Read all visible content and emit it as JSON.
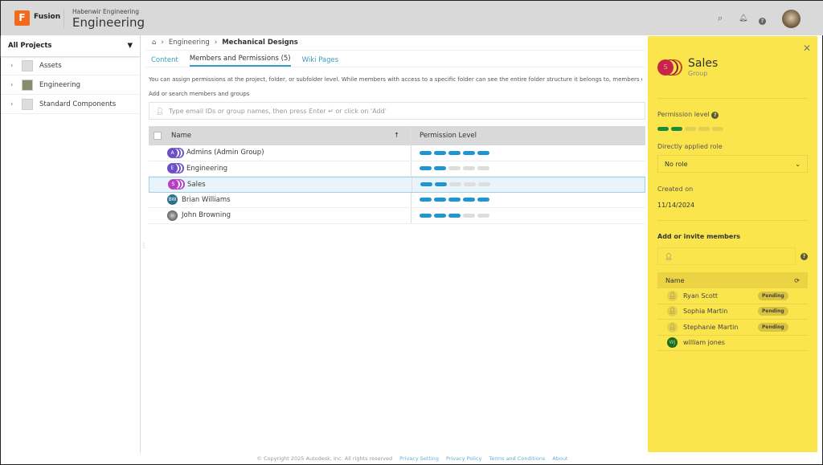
{
  "header": {
    "app": "Fusion",
    "logo_letter": "F",
    "hub": "Habenwir Engineering",
    "project": "Engineering",
    "icons": [
      "search-icon",
      "bell-icon",
      "help-icon",
      "user-avatar"
    ]
  },
  "sidebar": {
    "title": "All Projects",
    "items": [
      {
        "label": "Assets"
      },
      {
        "label": "Engineering"
      },
      {
        "label": "Standard Components"
      }
    ]
  },
  "breadcrumb": {
    "items": [
      "Engineering",
      "Mechanical Designs"
    ]
  },
  "tabs": [
    {
      "label": "Content"
    },
    {
      "label": "Members and Permissions (5)"
    },
    {
      "label": "Wiki Pages"
    }
  ],
  "info": "You can assign permissions at the project, folder, or subfolder level. While members with access to a specific folder can see the entire folder structure it belongs to, members can on",
  "add_label": "Add or search members and groups",
  "search_placeholder": "Type email IDs or group names, then press Enter ↵ or click on 'Add'",
  "table": {
    "headers": [
      "Name",
      "Permission Level"
    ],
    "rows": [
      {
        "name": "Admins (Admin Group)",
        "initials": "A",
        "level": 5,
        "color": "#6a4fc8"
      },
      {
        "name": "Engineering",
        "initials": "E",
        "level": 2,
        "color": "#6a4fc8"
      },
      {
        "name": "Sales",
        "initials": "S",
        "level": 2,
        "color": "#b73fc4"
      },
      {
        "name": "Brian Williams",
        "initials": "BW",
        "level": 5,
        "color": "#2d6f8e"
      },
      {
        "name": "John Browning",
        "initials": "",
        "level": 3,
        "color": "#555"
      }
    ]
  },
  "panel": {
    "name": "Sales",
    "type": "Group",
    "initial": "S",
    "permission_label": "Permission level",
    "permission_level": 2,
    "role_label": "Directly applied role",
    "role": "No role",
    "created_label": "Created on",
    "created": "11/14/2024",
    "invite_label": "Add or invite members",
    "members_header": "Name",
    "members": [
      {
        "name": "Ryan Scott",
        "status": "Pending"
      },
      {
        "name": "Sophia Martin",
        "status": "Pending"
      },
      {
        "name": "Stephanie Martin",
        "status": "Pending"
      },
      {
        "name": "william jones",
        "initials": "WJ"
      }
    ]
  },
  "footer": {
    "copyright": "© Copyright 2025 Autodesk, Inc. All rights reserved",
    "links": [
      "Privacy Setting",
      "Privacy Policy",
      "Terms and Conditions",
      "About"
    ]
  }
}
